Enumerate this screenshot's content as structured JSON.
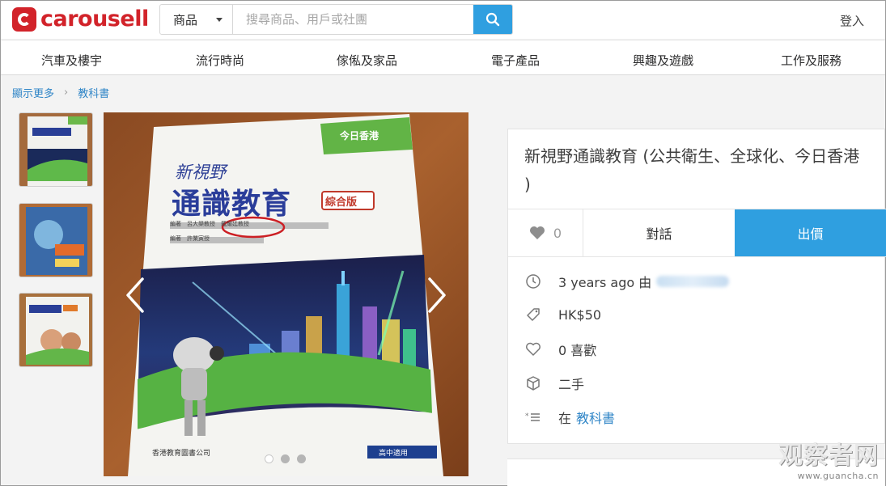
{
  "header": {
    "logo_text": "carousell",
    "search_category": "商品",
    "search_placeholder": "搜尋商品、用戶或社團",
    "login_label": "登入"
  },
  "nav": {
    "items": [
      "汽車及樓宇",
      "流行時尚",
      "傢俬及家品",
      "電子產品",
      "興趣及遊戲",
      "工作及服務"
    ]
  },
  "breadcrumb": {
    "items": [
      "顯示更多",
      "教科書"
    ]
  },
  "photo": {
    "book_title_small": "新視野",
    "book_title_large": "通識教育",
    "book_edition": "綜合版",
    "corner_badge": "今日香港",
    "authors_line1": "編著　呂大樂教授　戴耀廷教授",
    "authors_line2": "編著　許業寅授",
    "publisher": "香港教育圖書公司",
    "level_tag": "高中適用",
    "slide_count": 3,
    "active_slide": 1
  },
  "listing": {
    "title": "新視野通識教育 (公共衛生、全球化、今日香港 )",
    "like_count": "0",
    "chat_label": "對話",
    "offer_label": "出價",
    "posted_prefix": "3 years ago 由",
    "price": "HK$50",
    "likes_text": "0 喜歡",
    "condition": "二手",
    "category_prefix": "在",
    "category": "教科書"
  },
  "watermark": {
    "text": "观察者网",
    "url": "www.guancha.cn"
  },
  "colors": {
    "brand_red": "#d2232a",
    "accent_blue": "#2f9fe0",
    "link_blue": "#2f85c7"
  }
}
